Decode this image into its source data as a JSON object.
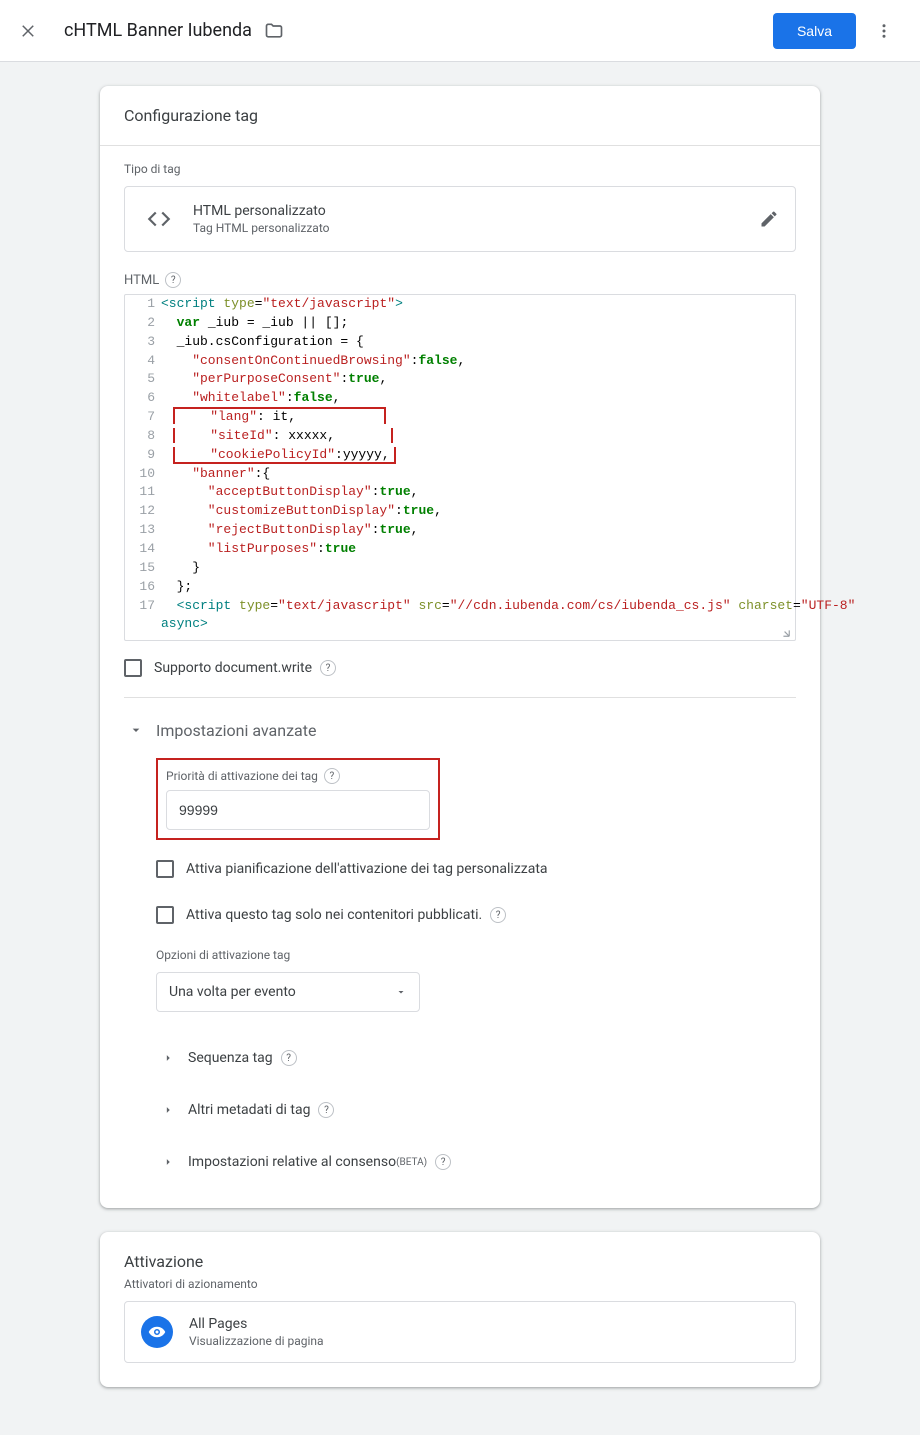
{
  "header": {
    "title": "cHTML Banner Iubenda",
    "save_label": "Salva"
  },
  "config": {
    "card_title": "Configurazione tag",
    "tag_type_label": "Tipo di tag",
    "tag_type_title": "HTML personalizzato",
    "tag_type_sub": "Tag HTML personalizzato",
    "html_label": "HTML",
    "code": {
      "l1_a": "<script ",
      "l1_b": "type",
      "l1_c": "=",
      "l1_d": "\"text/javascript\"",
      "l1_e": ">",
      "l2_a": "  var",
      "l2_b": " _iub = _iub || [];",
      "l3": "  _iub.csConfiguration = {",
      "l4_a": "    \"consentOnContinuedBrowsing\"",
      "l4_b": ":",
      "l4_c": "false",
      "l4_d": ",",
      "l5_a": "    \"perPurposeConsent\"",
      "l5_b": ":",
      "l5_c": "true",
      "l5_d": ",",
      "l6_a": "    \"whitelabel\"",
      "l6_b": ":",
      "l6_c": "false",
      "l6_d": ",",
      "l7_a": "    \"lang\"",
      "l7_b": ": it,",
      "l8_a": "    \"siteId\"",
      "l8_b": ": xxxxx,",
      "l9_a": "    \"cookiePolicyId\"",
      "l9_b": ":yyyyy,",
      "l10_a": "    \"banner\"",
      "l10_b": ":{",
      "l11_a": "      \"acceptButtonDisplay\"",
      "l11_b": ":",
      "l11_c": "true",
      "l11_d": ",",
      "l12_a": "      \"customizeButtonDisplay\"",
      "l12_b": ":",
      "l12_c": "true",
      "l12_d": ",",
      "l13_a": "      \"rejectButtonDisplay\"",
      "l13_b": ":",
      "l13_c": "true",
      "l13_d": ",",
      "l14_a": "      \"listPurposes\"",
      "l14_b": ":",
      "l14_c": "true",
      "l15": "    }",
      "l16": "  };",
      "l17_a": "  <script ",
      "l17_b": "type",
      "l17_c": "=",
      "l17_d": "\"text/javascript\"",
      "l17_e": " src",
      "l17_f": "=",
      "l17_g": "\"//cdn.iubenda.com/cs/iubenda_cs.js\"",
      "l17_h": " charset",
      "l17_i": "=",
      "l17_j": "\"UTF-8\"",
      "l18": "async>"
    },
    "support_docwrite": "Supporto document.write",
    "advanced_label": "Impostazioni avanzate",
    "priority_label": "Priorità di attivazione dei tag",
    "priority_value": "99999",
    "schedule_label": "Attiva pianificazione dell'attivazione dei tag personalizzata",
    "published_only_label": "Attiva questo tag solo nei contenitori pubblicati.",
    "options_label": "Opzioni di attivazione tag",
    "options_value": "Una volta per evento",
    "seq_label": "Sequenza tag",
    "meta_label": "Altri metadati di tag",
    "consent_label": "Impostazioni relative al consenso ",
    "beta_label": "(BETA)"
  },
  "activation": {
    "card_title": "Attivazione",
    "triggers_label": "Attivatori di azionamento",
    "trigger_name": "All Pages",
    "trigger_sub": "Visualizzazione di pagina"
  },
  "gutter": {
    "n1": "1",
    "n2": "2",
    "n3": "3",
    "n4": "4",
    "n5": "5",
    "n6": "6",
    "n7": "7",
    "n8": "8",
    "n9": "9",
    "n10": "10",
    "n11": "11",
    "n12": "12",
    "n13": "13",
    "n14": "14",
    "n15": "15",
    "n16": "16",
    "n17": "17"
  }
}
